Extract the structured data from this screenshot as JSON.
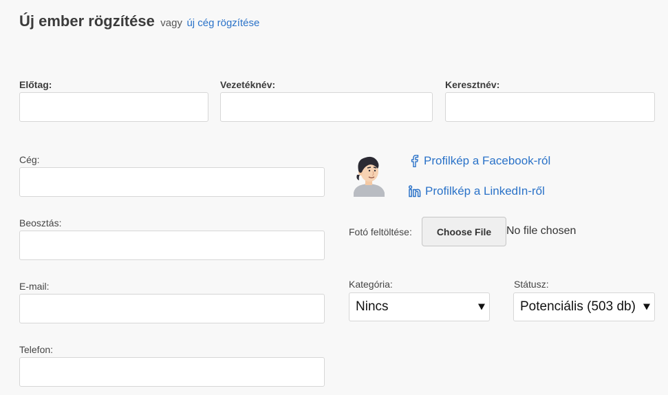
{
  "header": {
    "title": "Új ember rögzítése",
    "or_text": "vagy",
    "company_link": "új cég rögzítése"
  },
  "form": {
    "prefix_label": "Előtag:",
    "lastname_label": "Vezetéknév:",
    "firstname_label": "Keresztnév:",
    "company_label": "Cég:",
    "position_label": "Beosztás:",
    "email_label": "E-mail:",
    "phone_label": "Telefon:"
  },
  "profile": {
    "facebook_link": "Profilkép a Facebook-ról",
    "linkedin_link": "Profilkép a LinkedIn-ről",
    "upload_label": "Fotó feltöltése:",
    "choose_file_label": "Choose File",
    "no_file_text": "No file chosen"
  },
  "category": {
    "label": "Kategória:",
    "selected": "Nincs"
  },
  "status": {
    "label": "Státusz:",
    "selected": "Potenciális (503 db)"
  },
  "colors": {
    "link": "#2a72c8",
    "background": "#f8f8f8"
  },
  "icons": [
    "facebook-icon",
    "linkedin-icon",
    "avatar",
    "caret-down-icon"
  ]
}
